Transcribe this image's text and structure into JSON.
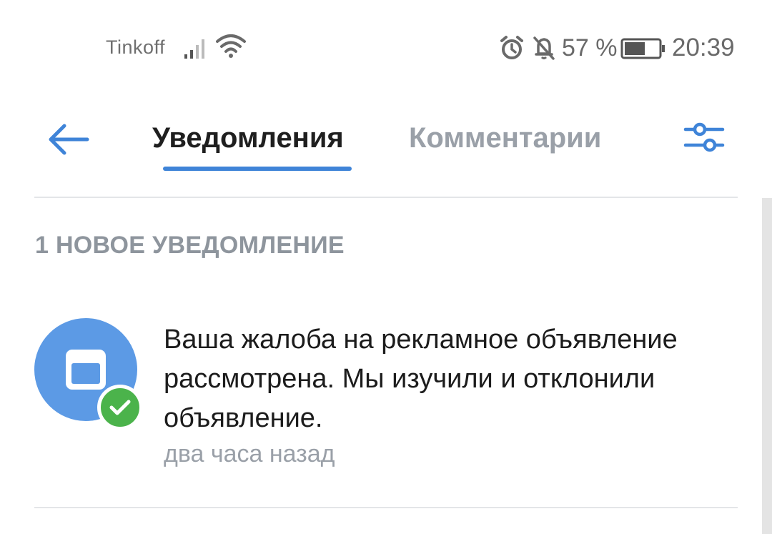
{
  "status_bar": {
    "carrier": "Tinkoff",
    "battery_percent": "57 %",
    "time": "20:39",
    "icons": [
      "signal-icon",
      "wifi-icon",
      "alarm-icon",
      "bell-off-icon",
      "battery-icon"
    ]
  },
  "nav": {
    "back_icon": "arrow-left-icon",
    "tabs": [
      {
        "label": "Уведомления",
        "active": true
      },
      {
        "label": "Комментарии",
        "active": false
      }
    ],
    "settings_icon": "sliders-icon"
  },
  "section_header": "1 НОВОЕ УВЕДОМЛЕНИЕ",
  "notifications": [
    {
      "icon": "ad-window-icon",
      "badge_icon": "check-icon",
      "text": "Ваша жалоба на рекламное объявление рассмотрена. Мы изучили и отклонили объявление.",
      "time": "два часа назад"
    }
  ],
  "colors": {
    "accent": "#3f84d8",
    "avatar": "#5c9ae5",
    "success": "#4bb34b",
    "secondary_text": "#9aa0a8"
  }
}
